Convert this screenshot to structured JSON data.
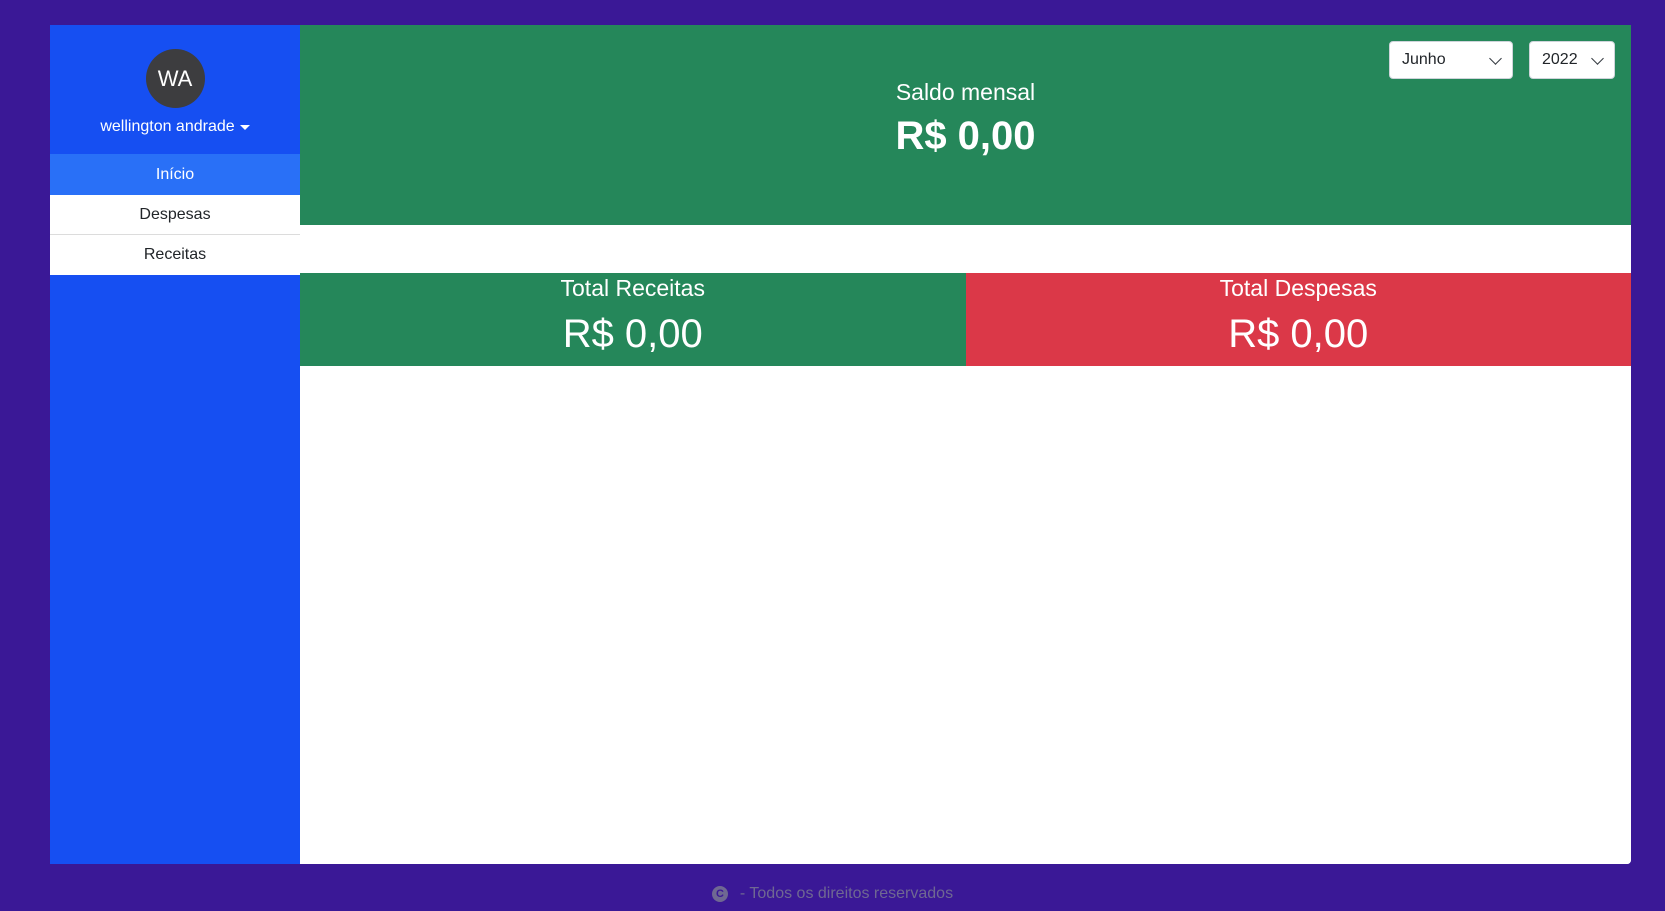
{
  "sidebar": {
    "avatar_initials": "WA",
    "username": "wellington andrade",
    "items": [
      {
        "label": "Início",
        "active": true
      },
      {
        "label": "Despesas",
        "active": false
      },
      {
        "label": "Receitas",
        "active": false
      }
    ]
  },
  "header": {
    "title": "Saldo mensal",
    "value": "R$ 0,00",
    "month_select": {
      "value": "Junho"
    },
    "year_select": {
      "value": "2022"
    }
  },
  "totals": {
    "receitas": {
      "title": "Total Receitas",
      "value": "R$ 0,00"
    },
    "despesas": {
      "title": "Total Despesas",
      "value": "R$ 0,00"
    }
  },
  "footer": {
    "icon": "copyright-icon",
    "text": "- Todos os direitos reservados"
  },
  "colors": {
    "page_background": "#3a1896",
    "sidebar": "#164ff2",
    "active_item": "#2970f7",
    "positive": "#25875a",
    "negative": "#db3848"
  }
}
